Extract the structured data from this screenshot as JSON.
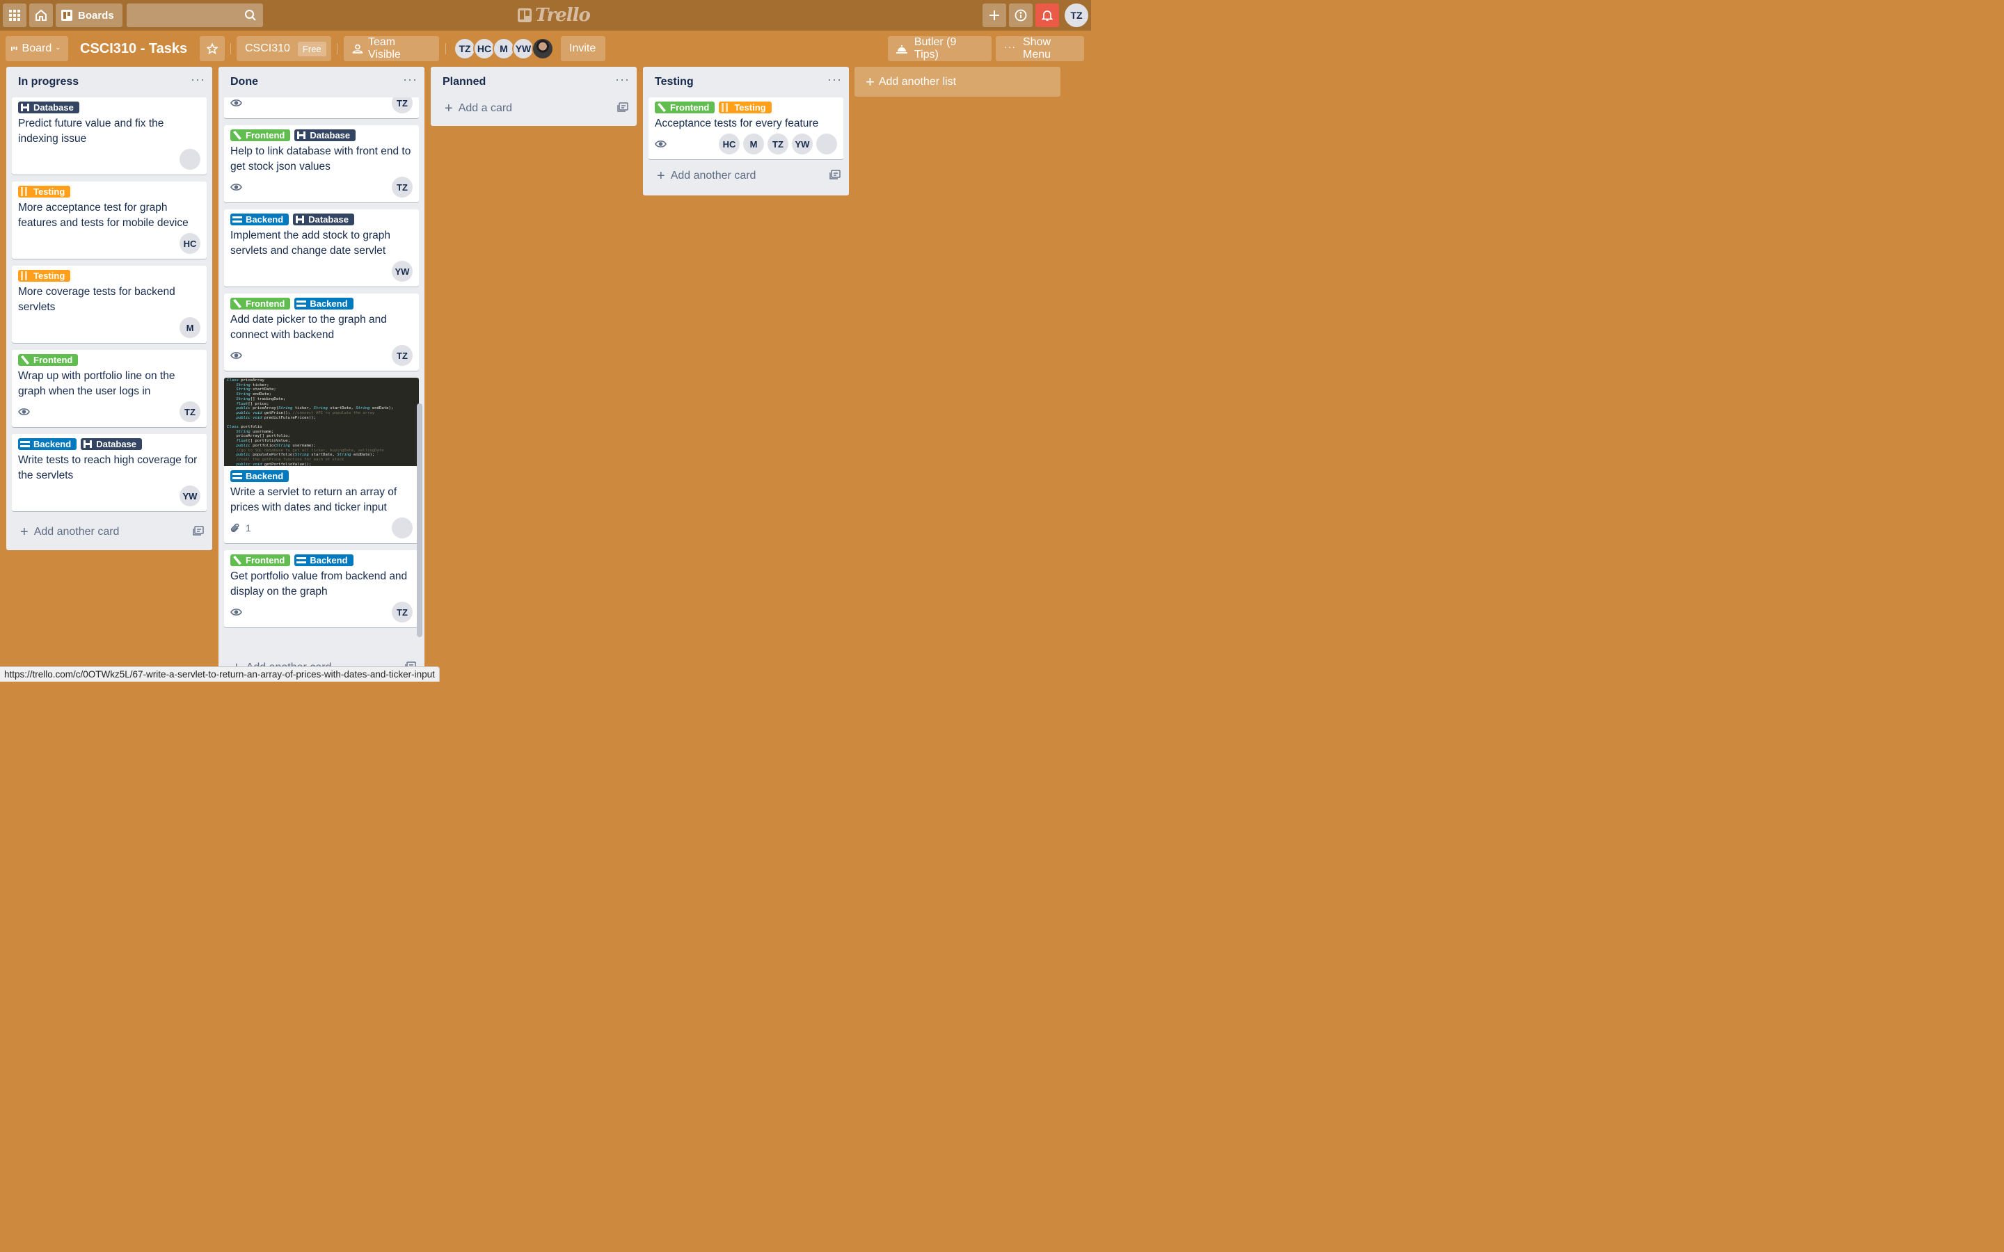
{
  "header": {
    "boards_label": "Boards",
    "logo_text": "Trello",
    "user_initials": "TZ"
  },
  "board_header": {
    "view_label": "Board",
    "title": "CSCI310 - Tasks",
    "team_name": "CSCI310",
    "team_badge": "Free",
    "visibility_label": "Team Visible",
    "members": [
      "TZ",
      "HC",
      "M",
      "YW"
    ],
    "invite_label": "Invite",
    "butler_label": "Butler (9 Tips)",
    "show_menu_label": "Show Menu"
  },
  "label_colors": {
    "Database": "#344563",
    "Testing": "#FF9F1A",
    "Frontend": "#61BD4F",
    "Backend": "#0079BF"
  },
  "lists": [
    {
      "title": "In progress",
      "cards": [
        {
          "labels": [
            "Database"
          ],
          "title": "Predict future value and fix the indexing issue",
          "members": [
            "photo"
          ]
        },
        {
          "labels": [
            "Testing"
          ],
          "title": "More acceptance test for graph features and tests for mobile device",
          "members": [
            "HC"
          ]
        },
        {
          "labels": [
            "Testing"
          ],
          "title": "More coverage tests for backend servlets",
          "members": [
            "M"
          ]
        },
        {
          "labels": [
            "Frontend"
          ],
          "title": "Wrap up with portfolio line on the graph when the user logs in",
          "watch": true,
          "members": [
            "TZ"
          ]
        },
        {
          "labels": [
            "Backend",
            "Database"
          ],
          "title": "Write tests to reach high coverage for the servlets",
          "members": [
            "YW"
          ]
        }
      ],
      "add_label": "Add another card"
    },
    {
      "title": "Done",
      "cards": [
        {
          "labels": [],
          "title": "",
          "watch": true,
          "members": [
            "TZ"
          ]
        },
        {
          "labels": [
            "Frontend",
            "Database"
          ],
          "title": "Help to link database with front end to get stock json values",
          "watch": true,
          "members": [
            "TZ"
          ]
        },
        {
          "labels": [
            "Backend",
            "Database"
          ],
          "title": "Implement the add stock to graph servlets and change date servlet",
          "members": [
            "YW"
          ]
        },
        {
          "labels": [
            "Frontend",
            "Backend"
          ],
          "title": "Add date picker to the graph and connect with backend",
          "watch": true,
          "members": [
            "TZ"
          ]
        },
        {
          "labels": [
            "Backend"
          ],
          "title": "Write a servlet to return an array of prices with dates and ticker input",
          "attachments": "1",
          "members": [
            "photo"
          ],
          "cover": "code"
        },
        {
          "labels": [
            "Frontend",
            "Backend"
          ],
          "title": "Get portfolio value from backend and display on the graph",
          "watch": true,
          "members": [
            "TZ"
          ]
        }
      ],
      "add_label": "Add another card"
    },
    {
      "title": "Planned",
      "cards": [],
      "add_label": "Add a card"
    },
    {
      "title": "Testing",
      "cards": [
        {
          "labels": [
            "Frontend",
            "Testing"
          ],
          "title": "Acceptance tests for every feature",
          "watch": true,
          "members": [
            "HC",
            "M",
            "TZ",
            "YW",
            "photo"
          ]
        }
      ],
      "add_label": "Add another card"
    }
  ],
  "add_list_label": "Add another list",
  "code_cover_lines": [
    "Class priceArray",
    "    String ticker;",
    "    String startDate;",
    "    String endDate;",
    "    String[] tradingDate;",
    "    float[] price;",
    "    public priceArray(String ticker, String startDate, String endDate);",
    "    public void getPrice(); //connect API to populate the array",
    "    public void predictFuturePrices();",
    "",
    "Class portfolio",
    "    String username;",
    "    priceArray[] portfolio;",
    "    float[] portfolioValue;",
    "    public portfolio(String username);",
    "    //go to SQL database to get all ticker, buyingDate, sellingDate",
    "    public populatePortfolio(String startDate, String endDate);",
    "    //call the getPrice function for each of stock",
    "    public void getPortfolioValue();"
  ],
  "status_url": "https://trello.com/c/0OTWkz5L/67-write-a-servlet-to-return-an-array-of-prices-with-dates-and-ticker-input"
}
